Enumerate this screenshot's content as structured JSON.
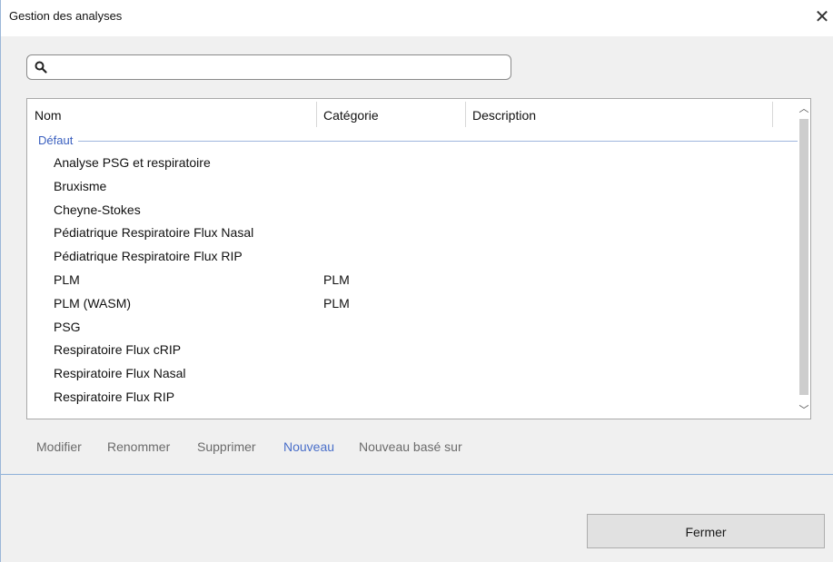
{
  "window": {
    "title": "Gestion des analyses",
    "close_glyph": "✕"
  },
  "search": {
    "value": "",
    "placeholder": "",
    "icon": "search-icon"
  },
  "table": {
    "columns": [
      "Nom",
      "Catégorie",
      "Description"
    ],
    "group_label": "Défaut",
    "rows": [
      {
        "name": "Analyse PSG et respiratoire",
        "category": ""
      },
      {
        "name": "Bruxisme",
        "category": ""
      },
      {
        "name": "Cheyne-Stokes",
        "category": ""
      },
      {
        "name": "Pédiatrique Respiratoire Flux Nasal",
        "category": ""
      },
      {
        "name": "Pédiatrique Respiratoire Flux RIP",
        "category": ""
      },
      {
        "name": "PLM",
        "category": "PLM"
      },
      {
        "name": "PLM (WASM)",
        "category": "PLM"
      },
      {
        "name": "PSG",
        "category": ""
      },
      {
        "name": "Respiratoire Flux cRIP",
        "category": ""
      },
      {
        "name": "Respiratoire Flux Nasal",
        "category": ""
      },
      {
        "name": "Respiratoire Flux RIP",
        "category": ""
      }
    ]
  },
  "actions": {
    "modify": "Modifier",
    "rename": "Renommer",
    "delete": "Supprimer",
    "new": "Nouveau",
    "new_based_on": "Nouveau basé sur"
  },
  "footer": {
    "close_label": "Fermer"
  },
  "colors": {
    "accent": "#4a6fc9",
    "group_line": "#9fb6dd"
  }
}
